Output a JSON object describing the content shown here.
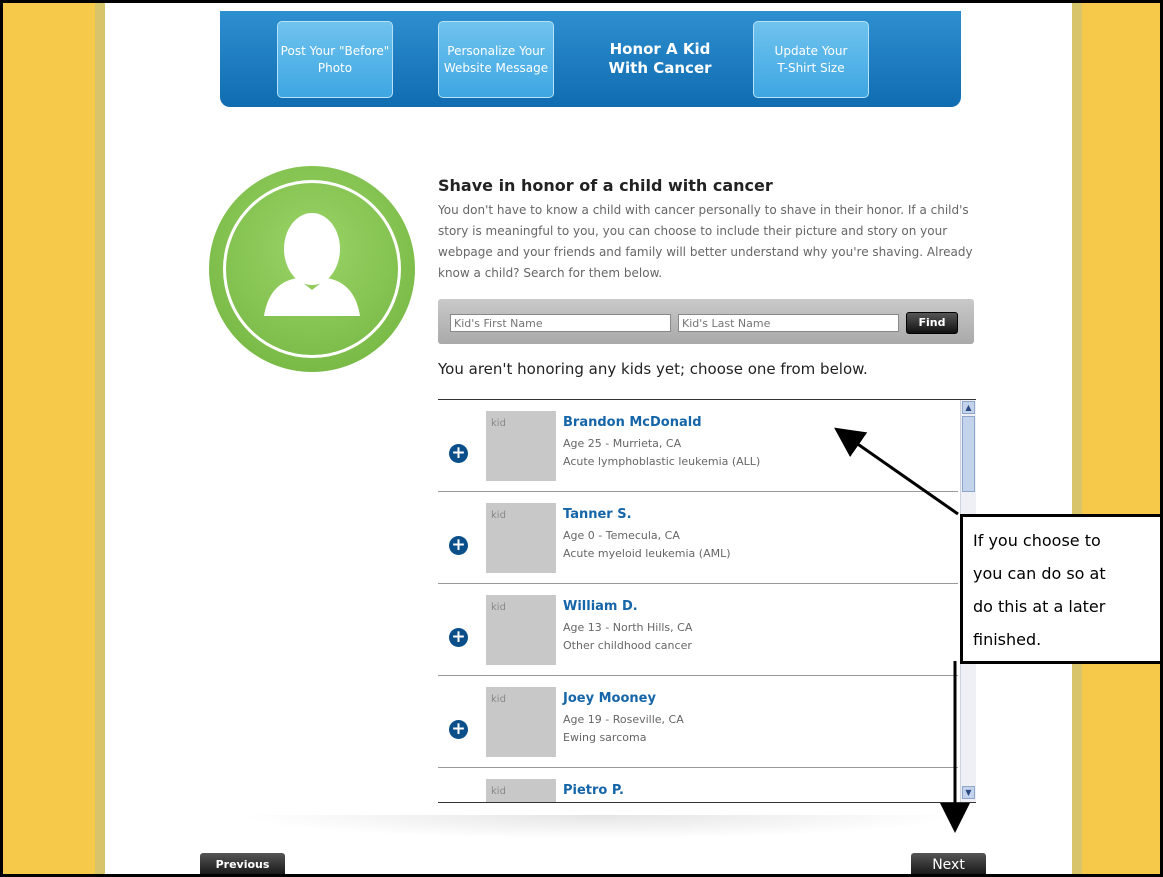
{
  "steps": [
    {
      "line1": "Post Your \"Before\"",
      "line2": "Photo"
    },
    {
      "line1": "Personalize Your",
      "line2": "Website Message"
    },
    {
      "line1": "Honor A Kid",
      "line2": "With Cancer"
    },
    {
      "line1": "Update Your",
      "line2": "T-Shirt Size"
    }
  ],
  "intro": {
    "title": "Shave in honor of a child with cancer",
    "text": "You don't have to know a child with cancer personally to shave in their honor. If a child's story is meaningful to you, you can choose to include their picture and story on your webpage and your friends and family will better understand why you're shaving. Already know a child? Search for them below."
  },
  "search": {
    "first_placeholder": "Kid's First Name",
    "last_placeholder": "Kid's Last Name",
    "find_label": "Find"
  },
  "status_message": "You aren't honoring any kids yet; choose one from below.",
  "kids": [
    {
      "photo_alt": "kid",
      "name": "Brandon McDonald",
      "age_location": "Age 25 - Murrieta, CA",
      "diagnosis": "Acute lymphoblastic leukemia (ALL)"
    },
    {
      "photo_alt": "kid",
      "name": "Tanner S.",
      "age_location": "Age 0 - Temecula, CA",
      "diagnosis": "Acute myeloid leukemia (AML)"
    },
    {
      "photo_alt": "kid",
      "name": "William D.",
      "age_location": "Age 13 - North Hills, CA",
      "diagnosis": "Other childhood cancer"
    },
    {
      "photo_alt": "kid",
      "name": "Joey Mooney",
      "age_location": "Age 19 - Roseville, CA",
      "diagnosis": "Ewing sarcoma"
    },
    {
      "photo_alt": "kid",
      "name": "Pietro P.",
      "age_location": "",
      "diagnosis": ""
    }
  ],
  "nav": {
    "previous_label": "Previous",
    "next_label": "Next"
  },
  "callout": {
    "lines": [
      "If you choose to",
      "you can do so at",
      "do this at a later",
      "finished."
    ]
  },
  "icons": {
    "add": "plus-circle-icon",
    "avatar": "person-silhouette-icon"
  },
  "colors": {
    "accent_blue": "#0f6cb0",
    "side_yellow": "#f6c94a",
    "avatar_green": "#7cc046",
    "link_blue": "#1565a8"
  }
}
